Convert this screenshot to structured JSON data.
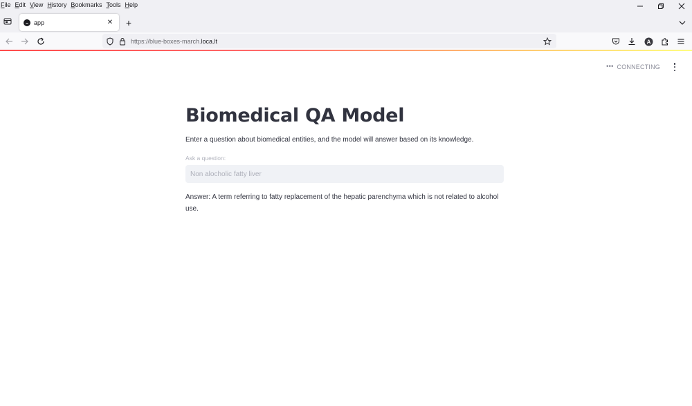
{
  "menu": {
    "items": [
      {
        "label": "File",
        "underline": "F",
        "rest": "ile"
      },
      {
        "label": "Edit",
        "underline": "E",
        "rest": "dit"
      },
      {
        "label": "View",
        "underline": "V",
        "rest": "iew"
      },
      {
        "label": "History",
        "underline": "H",
        "rest": "istory"
      },
      {
        "label": "Bookmarks",
        "underline": "B",
        "rest": "ookmarks"
      },
      {
        "label": "Tools",
        "underline": "T",
        "rest": "ools"
      },
      {
        "label": "Help",
        "underline": "H",
        "rest": "elp"
      }
    ]
  },
  "tab": {
    "title": "app"
  },
  "urlbar": {
    "prefix": "https://blue-boxes-march.",
    "host": "loca.lt"
  },
  "app": {
    "status": "CONNECTING",
    "title": "Biomedical QA Model",
    "description": "Enter a question about biomedical entities, and the model will answer based on its knowledge.",
    "input_label": "Ask a question:",
    "input_value": "Non alocholic fatty liver",
    "answer": "Answer: A term referring to fatty replacement of the hepatic parenchyma which is not related to alcohol use."
  },
  "colors": {
    "accent": "#ff4b4b",
    "text": "#31333f",
    "input_bg": "#f0f2f6",
    "chrome_bg": "#f0f0f4"
  }
}
